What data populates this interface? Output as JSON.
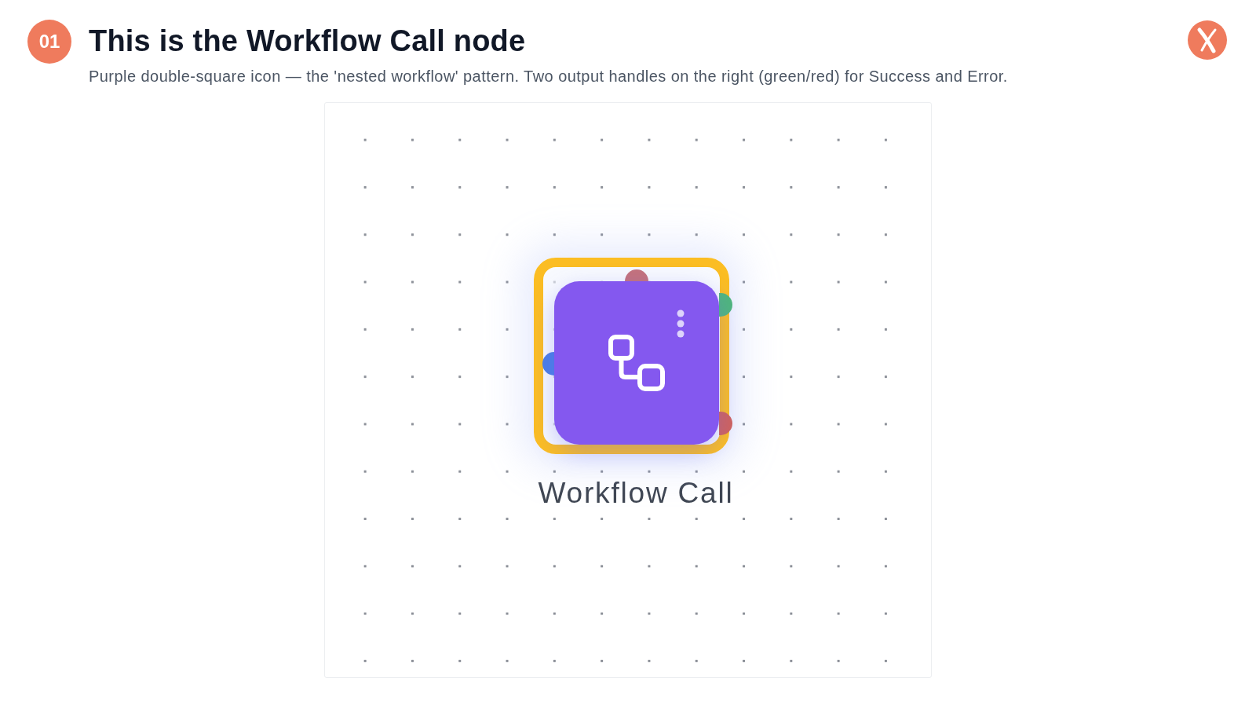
{
  "header": {
    "step": "01",
    "title": "This is the Workflow Call node",
    "subtitle": "Purple double-square icon — the 'nested workflow' pattern. Two output handles on the right (green/red) for Success and Error."
  },
  "canvas": {
    "node": {
      "label": "Workflow Call",
      "highlighted": true,
      "handles": [
        {
          "color": "#c4727c"
        },
        {
          "color": "#4fb67c"
        },
        {
          "color": "#4a7ee6"
        },
        {
          "color": "#d0625c"
        }
      ]
    }
  }
}
